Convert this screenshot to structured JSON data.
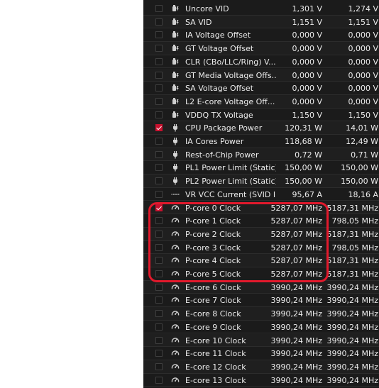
{
  "accent_color": "#e2192c",
  "checkbox_checked_color": "#c8102e",
  "rows": [
    {
      "icon": "voltage-icon",
      "label": "Uncore VID",
      "value1": "1,301 V",
      "value2": "1,274 V",
      "checked": false
    },
    {
      "icon": "voltage-icon",
      "label": "SA VID",
      "value1": "1,151 V",
      "value2": "1,151 V",
      "checked": false
    },
    {
      "icon": "voltage-icon",
      "label": "IA Voltage Offset",
      "value1": "0,000 V",
      "value2": "0,000 V",
      "checked": false
    },
    {
      "icon": "voltage-icon",
      "label": "GT Voltage Offset",
      "value1": "0,000 V",
      "value2": "0,000 V",
      "checked": false
    },
    {
      "icon": "voltage-icon",
      "label": "CLR (CBo/LLC/Ring) V...",
      "value1": "0,000 V",
      "value2": "0,000 V",
      "checked": false
    },
    {
      "icon": "voltage-icon",
      "label": "GT Media Voltage Offs...",
      "value1": "0,000 V",
      "value2": "0,000 V",
      "checked": false
    },
    {
      "icon": "voltage-icon",
      "label": "SA Voltage Offset",
      "value1": "0,000 V",
      "value2": "0,000 V",
      "checked": false
    },
    {
      "icon": "voltage-icon",
      "label": "L2 E-core Voltage Off...",
      "value1": "0,000 V",
      "value2": "0,000 V",
      "checked": false
    },
    {
      "icon": "voltage-icon",
      "label": "VDDQ TX Voltage",
      "value1": "1,150 V",
      "value2": "1,150 V",
      "checked": false
    },
    {
      "icon": "power-plug-icon",
      "label": "CPU Package Power",
      "value1": "120,31 W",
      "value2": "14,01 W",
      "checked": true
    },
    {
      "icon": "power-plug-icon",
      "label": "IA Cores Power",
      "value1": "118,68 W",
      "value2": "12,49 W",
      "checked": false
    },
    {
      "icon": "power-plug-icon",
      "label": "Rest-of-Chip Power",
      "value1": "0,72 W",
      "value2": "0,71 W",
      "checked": false
    },
    {
      "icon": "power-plug-icon",
      "label": "PL1 Power Limit (Static)",
      "value1": "150,00 W",
      "value2": "150,00 W",
      "checked": false
    },
    {
      "icon": "power-plug-icon",
      "label": "PL2 Power Limit (Static)",
      "value1": "150,00 W",
      "value2": "150,00 W",
      "checked": false
    },
    {
      "icon": "current-icon",
      "label": "VR VCC Current (SVID I...",
      "value1": "95,67 A",
      "value2": "18,16 A",
      "checked": false
    },
    {
      "icon": "clock-gauge-icon",
      "label": "P-core 0 Clock",
      "value1": "5287,07 MHz",
      "value2": "5187,31 MHz",
      "checked": true
    },
    {
      "icon": "clock-gauge-icon",
      "label": "P-core 1 Clock",
      "value1": "5287,07 MHz",
      "value2": "798,05 MHz",
      "checked": false
    },
    {
      "icon": "clock-gauge-icon",
      "label": "P-core 2 Clock",
      "value1": "5287,07 MHz",
      "value2": "5187,31 MHz",
      "checked": false
    },
    {
      "icon": "clock-gauge-icon",
      "label": "P-core 3 Clock",
      "value1": "5287,07 MHz",
      "value2": "798,05 MHz",
      "checked": false
    },
    {
      "icon": "clock-gauge-icon",
      "label": "P-core 4 Clock",
      "value1": "5287,07 MHz",
      "value2": "5187,31 MHz",
      "checked": false
    },
    {
      "icon": "clock-gauge-icon",
      "label": "P-core 5 Clock",
      "value1": "5287,07 MHz",
      "value2": "5187,31 MHz",
      "checked": false
    },
    {
      "icon": "clock-gauge-icon",
      "label": "E-core 6 Clock",
      "value1": "3990,24 MHz",
      "value2": "3990,24 MHz",
      "checked": false
    },
    {
      "icon": "clock-gauge-icon",
      "label": "E-core 7 Clock",
      "value1": "3990,24 MHz",
      "value2": "3990,24 MHz",
      "checked": false
    },
    {
      "icon": "clock-gauge-icon",
      "label": "E-core 8 Clock",
      "value1": "3990,24 MHz",
      "value2": "3990,24 MHz",
      "checked": false
    },
    {
      "icon": "clock-gauge-icon",
      "label": "E-core 9 Clock",
      "value1": "3990,24 MHz",
      "value2": "3990,24 MHz",
      "checked": false
    },
    {
      "icon": "clock-gauge-icon",
      "label": "E-core 10 Clock",
      "value1": "3990,24 MHz",
      "value2": "3990,24 MHz",
      "checked": false
    },
    {
      "icon": "clock-gauge-icon",
      "label": "E-core 11 Clock",
      "value1": "3990,24 MHz",
      "value2": "3990,24 MHz",
      "checked": false
    },
    {
      "icon": "clock-gauge-icon",
      "label": "E-core 12 Clock",
      "value1": "3990,24 MHz",
      "value2": "3990,24 MHz",
      "checked": false
    },
    {
      "icon": "clock-gauge-icon",
      "label": "E-core 13 Clock",
      "value1": "3990,24 MHz",
      "value2": "3990,24 MHz",
      "checked": false
    }
  ]
}
